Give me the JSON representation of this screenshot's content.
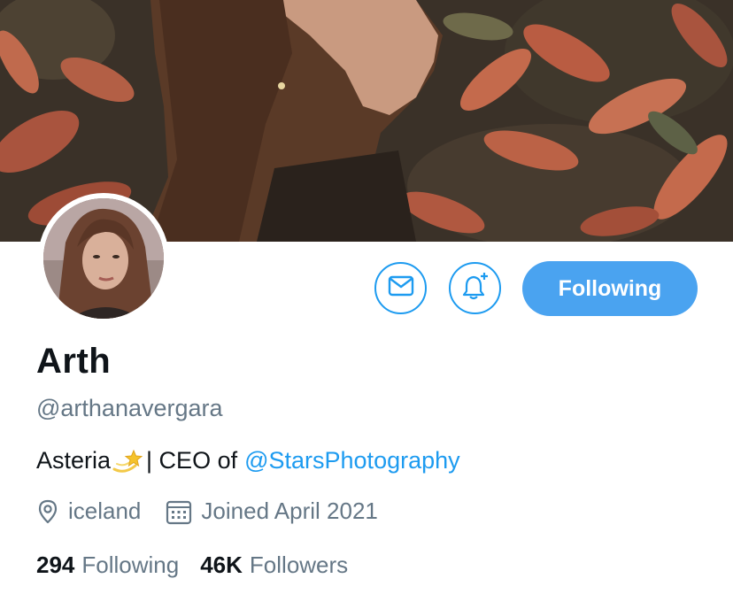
{
  "profile": {
    "name": "Arth",
    "handle": "@arthanavergara",
    "bio": {
      "text_before": "Asteria",
      "emoji": "dizzy-star-emoji",
      "text_after": "| CEO of",
      "mention": "@StarsPhotography"
    },
    "location": "iceland",
    "joined": "Joined April 2021"
  },
  "actions": {
    "message_icon": "envelope-icon",
    "notify_icon": "bell-plus-icon",
    "follow_label": "Following"
  },
  "stats": {
    "following_count": "294",
    "following_label": "Following",
    "followers_count": "46K",
    "followers_label": "Followers"
  },
  "colors": {
    "accent": "#1d9bf0",
    "follow_button": "#4aa3f0",
    "secondary_text": "#657786",
    "primary_text": "#0f1419"
  }
}
